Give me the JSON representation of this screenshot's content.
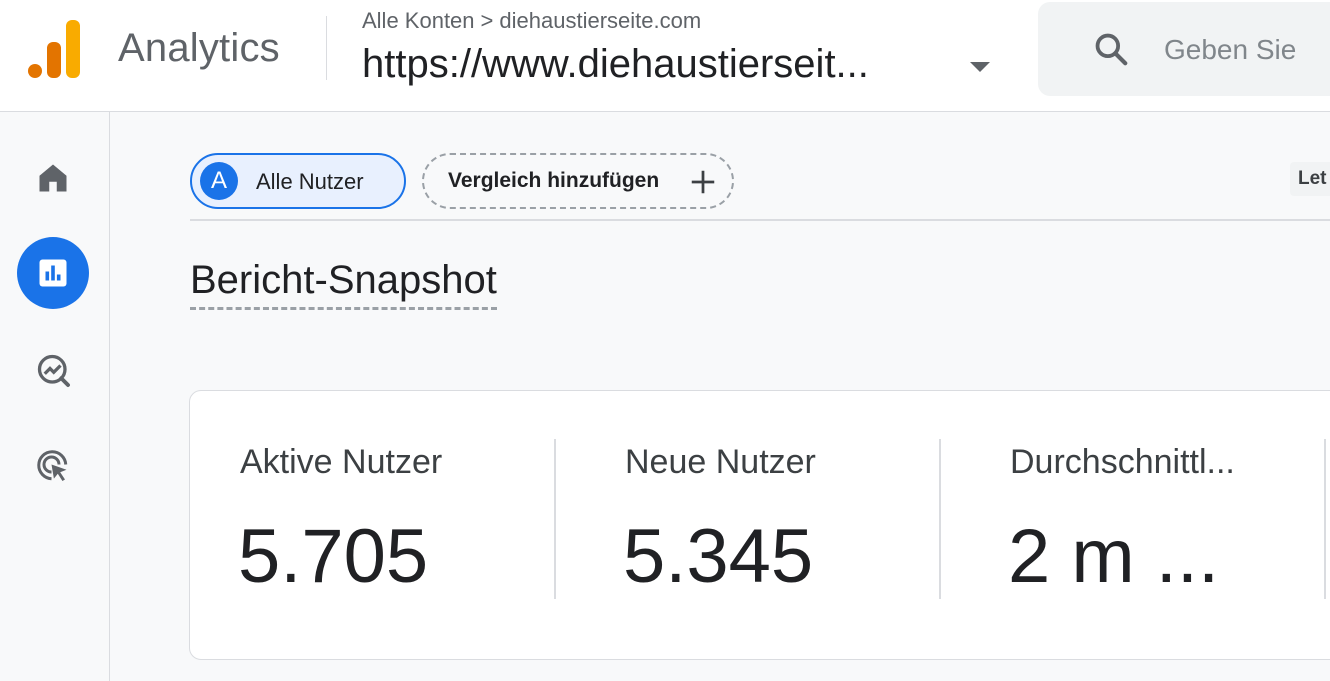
{
  "header": {
    "app_name": "Analytics",
    "breadcrumb": {
      "account": "Alle Konten",
      "separator": ">",
      "site": "diehaustierseite.com"
    },
    "property_name": "https://www.diehaustierseit...",
    "search_placeholder": "Geben Sie"
  },
  "nav": {
    "items": [
      {
        "name": "home",
        "icon": "home-icon",
        "active": false
      },
      {
        "name": "reports",
        "icon": "bar-chart-icon",
        "active": true
      },
      {
        "name": "explore",
        "icon": "explore-trend-icon",
        "active": false
      },
      {
        "name": "advertising",
        "icon": "target-cursor-icon",
        "active": false
      }
    ]
  },
  "comparison": {
    "segment_avatar": "A",
    "segment_label": "Alle Nutzer",
    "add_comparison_label": "Vergleich hinzufügen",
    "date_range_partial": "Let"
  },
  "page": {
    "title": "Bericht-Snapshot"
  },
  "metrics": [
    {
      "label": "Aktive Nutzer",
      "value": "5.705"
    },
    {
      "label": "Neue Nutzer",
      "value": "5.345"
    },
    {
      "label": "Durchschnittl...",
      "value": "2 m ..."
    }
  ],
  "colors": {
    "accent": "#1a73e8",
    "logo_dark": "#e37400",
    "logo_light": "#f9ab00",
    "text_primary": "#202124",
    "text_secondary": "#5f6368"
  }
}
